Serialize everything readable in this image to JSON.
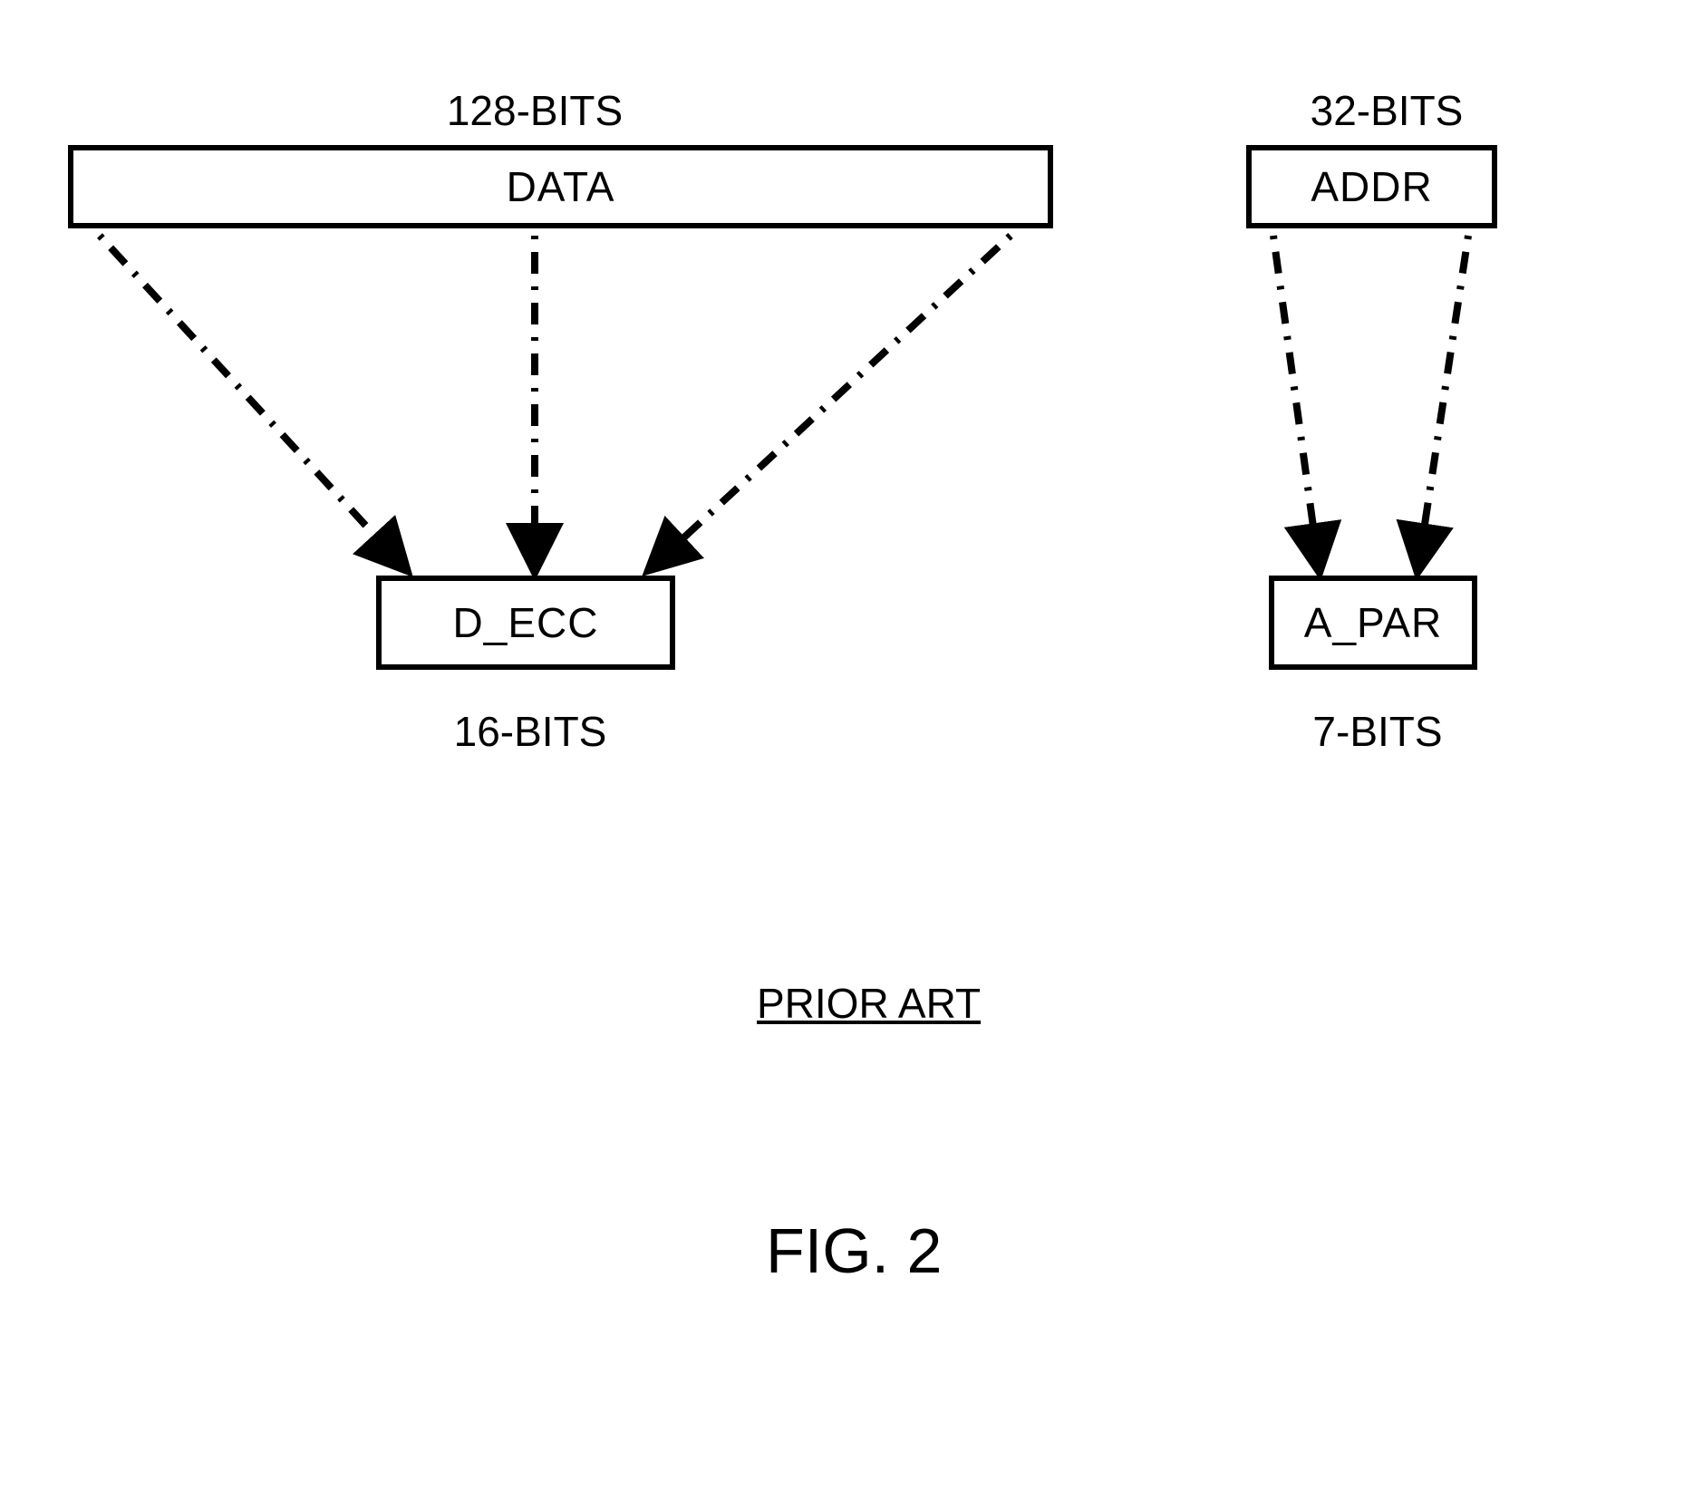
{
  "labels": {
    "data_bits": "128-BITS",
    "addr_bits": "32-BITS",
    "decc_bits": "16-BITS",
    "apar_bits": "7-BITS"
  },
  "boxes": {
    "data": "DATA",
    "addr": "ADDR",
    "decc": "D_ECC",
    "apar": "A_PAR"
  },
  "footer": {
    "prior_art": "PRIOR ART",
    "figure": "FIG. 2"
  },
  "chart_data": {
    "type": "diagram",
    "title": "FIG. 2 — Prior Art ECC/Parity generation",
    "blocks": [
      {
        "id": "DATA",
        "bits": 128,
        "role": "source"
      },
      {
        "id": "ADDR",
        "bits": 32,
        "role": "source"
      },
      {
        "id": "D_ECC",
        "bits": 16,
        "role": "derived"
      },
      {
        "id": "A_PAR",
        "bits": 7,
        "role": "derived"
      }
    ],
    "edges": [
      {
        "from": "DATA",
        "to": "D_ECC",
        "style": "dash-dot-converging"
      },
      {
        "from": "ADDR",
        "to": "A_PAR",
        "style": "dash-dot-converging"
      }
    ],
    "annotation": "PRIOR ART"
  }
}
